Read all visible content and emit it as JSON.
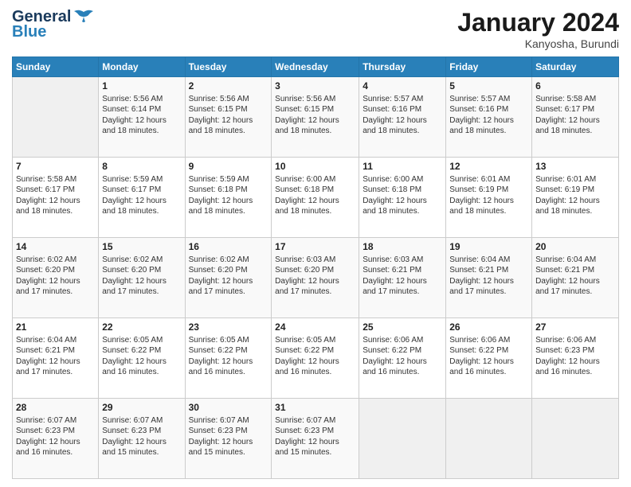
{
  "header": {
    "logo_general": "General",
    "logo_blue": "Blue",
    "month": "January 2024",
    "location": "Kanyosha, Burundi"
  },
  "days_of_week": [
    "Sunday",
    "Monday",
    "Tuesday",
    "Wednesday",
    "Thursday",
    "Friday",
    "Saturday"
  ],
  "weeks": [
    [
      {
        "day": "",
        "info": ""
      },
      {
        "day": "1",
        "info": "Sunrise: 5:56 AM\nSunset: 6:14 PM\nDaylight: 12 hours\nand 18 minutes."
      },
      {
        "day": "2",
        "info": "Sunrise: 5:56 AM\nSunset: 6:15 PM\nDaylight: 12 hours\nand 18 minutes."
      },
      {
        "day": "3",
        "info": "Sunrise: 5:56 AM\nSunset: 6:15 PM\nDaylight: 12 hours\nand 18 minutes."
      },
      {
        "day": "4",
        "info": "Sunrise: 5:57 AM\nSunset: 6:16 PM\nDaylight: 12 hours\nand 18 minutes."
      },
      {
        "day": "5",
        "info": "Sunrise: 5:57 AM\nSunset: 6:16 PM\nDaylight: 12 hours\nand 18 minutes."
      },
      {
        "day": "6",
        "info": "Sunrise: 5:58 AM\nSunset: 6:17 PM\nDaylight: 12 hours\nand 18 minutes."
      }
    ],
    [
      {
        "day": "7",
        "info": "Sunrise: 5:58 AM\nSunset: 6:17 PM\nDaylight: 12 hours\nand 18 minutes."
      },
      {
        "day": "8",
        "info": "Sunrise: 5:59 AM\nSunset: 6:17 PM\nDaylight: 12 hours\nand 18 minutes."
      },
      {
        "day": "9",
        "info": "Sunrise: 5:59 AM\nSunset: 6:18 PM\nDaylight: 12 hours\nand 18 minutes."
      },
      {
        "day": "10",
        "info": "Sunrise: 6:00 AM\nSunset: 6:18 PM\nDaylight: 12 hours\nand 18 minutes."
      },
      {
        "day": "11",
        "info": "Sunrise: 6:00 AM\nSunset: 6:18 PM\nDaylight: 12 hours\nand 18 minutes."
      },
      {
        "day": "12",
        "info": "Sunrise: 6:01 AM\nSunset: 6:19 PM\nDaylight: 12 hours\nand 18 minutes."
      },
      {
        "day": "13",
        "info": "Sunrise: 6:01 AM\nSunset: 6:19 PM\nDaylight: 12 hours\nand 18 minutes."
      }
    ],
    [
      {
        "day": "14",
        "info": "Sunrise: 6:02 AM\nSunset: 6:20 PM\nDaylight: 12 hours\nand 17 minutes."
      },
      {
        "day": "15",
        "info": "Sunrise: 6:02 AM\nSunset: 6:20 PM\nDaylight: 12 hours\nand 17 minutes."
      },
      {
        "day": "16",
        "info": "Sunrise: 6:02 AM\nSunset: 6:20 PM\nDaylight: 12 hours\nand 17 minutes."
      },
      {
        "day": "17",
        "info": "Sunrise: 6:03 AM\nSunset: 6:20 PM\nDaylight: 12 hours\nand 17 minutes."
      },
      {
        "day": "18",
        "info": "Sunrise: 6:03 AM\nSunset: 6:21 PM\nDaylight: 12 hours\nand 17 minutes."
      },
      {
        "day": "19",
        "info": "Sunrise: 6:04 AM\nSunset: 6:21 PM\nDaylight: 12 hours\nand 17 minutes."
      },
      {
        "day": "20",
        "info": "Sunrise: 6:04 AM\nSunset: 6:21 PM\nDaylight: 12 hours\nand 17 minutes."
      }
    ],
    [
      {
        "day": "21",
        "info": "Sunrise: 6:04 AM\nSunset: 6:21 PM\nDaylight: 12 hours\nand 17 minutes."
      },
      {
        "day": "22",
        "info": "Sunrise: 6:05 AM\nSunset: 6:22 PM\nDaylight: 12 hours\nand 16 minutes."
      },
      {
        "day": "23",
        "info": "Sunrise: 6:05 AM\nSunset: 6:22 PM\nDaylight: 12 hours\nand 16 minutes."
      },
      {
        "day": "24",
        "info": "Sunrise: 6:05 AM\nSunset: 6:22 PM\nDaylight: 12 hours\nand 16 minutes."
      },
      {
        "day": "25",
        "info": "Sunrise: 6:06 AM\nSunset: 6:22 PM\nDaylight: 12 hours\nand 16 minutes."
      },
      {
        "day": "26",
        "info": "Sunrise: 6:06 AM\nSunset: 6:22 PM\nDaylight: 12 hours\nand 16 minutes."
      },
      {
        "day": "27",
        "info": "Sunrise: 6:06 AM\nSunset: 6:23 PM\nDaylight: 12 hours\nand 16 minutes."
      }
    ],
    [
      {
        "day": "28",
        "info": "Sunrise: 6:07 AM\nSunset: 6:23 PM\nDaylight: 12 hours\nand 16 minutes."
      },
      {
        "day": "29",
        "info": "Sunrise: 6:07 AM\nSunset: 6:23 PM\nDaylight: 12 hours\nand 15 minutes."
      },
      {
        "day": "30",
        "info": "Sunrise: 6:07 AM\nSunset: 6:23 PM\nDaylight: 12 hours\nand 15 minutes."
      },
      {
        "day": "31",
        "info": "Sunrise: 6:07 AM\nSunset: 6:23 PM\nDaylight: 12 hours\nand 15 minutes."
      },
      {
        "day": "",
        "info": ""
      },
      {
        "day": "",
        "info": ""
      },
      {
        "day": "",
        "info": ""
      }
    ]
  ]
}
